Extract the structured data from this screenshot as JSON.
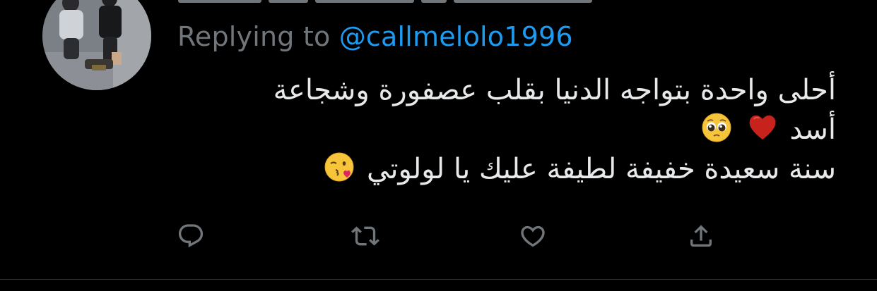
{
  "colors": {
    "background": "#000000",
    "text": "#e7e9ea",
    "secondary": "#71767b",
    "link": "#1d9bf0",
    "divider": "#2f3336"
  },
  "reply": {
    "prefix": "Replying to",
    "handle": "@callmelolo1996"
  },
  "tweet": {
    "lines": [
      {
        "text": "أحلى واحدة بتواجه الدنيا بقلب عصفورة وشجاعة"
      },
      {
        "text": "أسد",
        "emojis": [
          "red-heart-emoji",
          "pleading-face-emoji"
        ]
      },
      {
        "text": "سنة سعيدة خفيفة لطيفة عليك يا لولوتي",
        "emojis": [
          "face-blowing-kiss-emoji"
        ]
      }
    ]
  },
  "actions": [
    {
      "name": "reply",
      "icon": "reply-icon"
    },
    {
      "name": "retweet",
      "icon": "retweet-icon"
    },
    {
      "name": "like",
      "icon": "heart-icon"
    },
    {
      "name": "share",
      "icon": "share-icon"
    }
  ]
}
